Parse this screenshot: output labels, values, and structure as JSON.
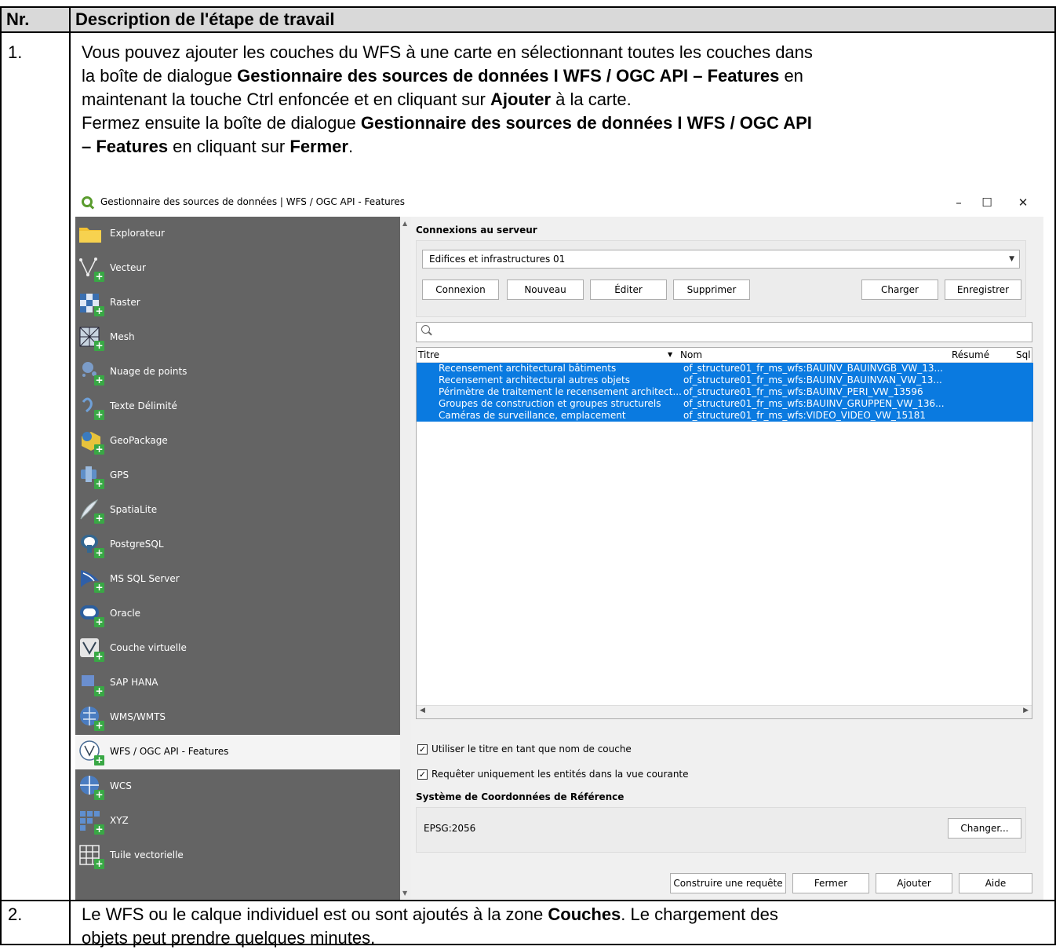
{
  "table": {
    "col_nr": "Nr.",
    "col_desc": "Description de l'étape de travail",
    "row1_nr": "1.",
    "row1_line1": "Vous pouvez ajouter les couches du WFS à une carte en sélectionnant toutes les couches dans",
    "row1_line2_pre": "la boîte de dialogue ",
    "row1_line2_bold": "Gestionnaire des sources de données I WFS / OGC API – Features",
    "row1_line2_post": " en",
    "row1_line3_pre": "maintenant la touche Ctrl enfoncée et en cliquant sur ",
    "row1_line3_bold": "Ajouter",
    "row1_line3_post": " à la carte.",
    "row1_line4_pre": "Fermez ensuite la boîte de dialogue ",
    "row1_line4_bold": "Gestionnaire des sources de données I WFS / OGC API",
    "row1_line5_bold1": "– Features",
    "row1_line5_mid": " en cliquant sur ",
    "row1_line5_bold2": "Fermer",
    "row1_line5_post": ".",
    "row2_nr": "2.",
    "row2_line1_pre": "Le WFS ou le calque individuel est ou sont ajoutés à la zone ",
    "row2_line1_bold": "Couches",
    "row2_line1_post": ". Le chargement des",
    "row2_line2": "objets peut prendre quelques minutes."
  },
  "dialog": {
    "title": "Gestionnaire des sources de données | WFS / OGC API - Features",
    "window_buttons": [
      "–",
      "☐",
      "✕"
    ],
    "sidebar": [
      {
        "label": "Explorateur",
        "icon": "folder-icon"
      },
      {
        "label": "Vecteur",
        "icon": "vector-icon"
      },
      {
        "label": "Raster",
        "icon": "raster-icon"
      },
      {
        "label": "Mesh",
        "icon": "mesh-icon"
      },
      {
        "label": "Nuage de points",
        "icon": "point-cloud-icon"
      },
      {
        "label": "Texte Délimité",
        "icon": "delimited-text-icon"
      },
      {
        "label": "GeoPackage",
        "icon": "geopackage-icon"
      },
      {
        "label": "GPS",
        "icon": "gps-icon"
      },
      {
        "label": "SpatiaLite",
        "icon": "spatialite-icon"
      },
      {
        "label": "PostgreSQL",
        "icon": "postgresql-icon"
      },
      {
        "label": "MS SQL Server",
        "icon": "mssql-icon"
      },
      {
        "label": "Oracle",
        "icon": "oracle-icon"
      },
      {
        "label": "Couche virtuelle",
        "icon": "virtual-layer-icon"
      },
      {
        "label": "SAP HANA",
        "icon": "sap-hana-icon"
      },
      {
        "label": "WMS/WMTS",
        "icon": "wms-icon"
      },
      {
        "label": "WFS / OGC API - Features",
        "icon": "wfs-icon"
      },
      {
        "label": "WCS",
        "icon": "wcs-icon"
      },
      {
        "label": "XYZ",
        "icon": "xyz-icon"
      },
      {
        "label": "Tuile vectorielle",
        "icon": "vector-tile-icon"
      }
    ],
    "selected_sidebar": "WFS / OGC API - Features",
    "connexions_title": "Connexions au serveur",
    "connection_selected": "Edifices et infrastructures 01",
    "buttons": {
      "connexion": "Connexion",
      "nouveau": "Nouveau",
      "editer": "Éditer",
      "supprimer": "Supprimer",
      "charger": "Charger",
      "enregistrer": "Enregistrer"
    },
    "search_placeholder": "",
    "columns": [
      "Titre",
      "Nom",
      "Résumé",
      "Sql"
    ],
    "rows": [
      {
        "titre": "Recensement architectural bâtiments",
        "nom": "of_structure01_fr_ms_wfs:BAUINV_BAUINVGB_VW_13..."
      },
      {
        "titre": "Recensement architectural autres objets",
        "nom": "of_structure01_fr_ms_wfs:BAUINV_BAUINVAN_VW_13..."
      },
      {
        "titre": "Périmètre de traitement le recensement architect...",
        "nom": "of_structure01_fr_ms_wfs:BAUINV_PERI_VW_13596"
      },
      {
        "titre": "Groupes de construction et groupes structurels",
        "nom": "of_structure01_fr_ms_wfs:BAUINV_GRUPPEN_VW_136..."
      },
      {
        "titre": "Caméras de surveillance, emplacement",
        "nom": "of_structure01_fr_ms_wfs:VIDEO_VIDEO_VW_15181"
      }
    ],
    "check_title": "Utiliser le titre en tant que nom de couche",
    "check_query": "Requêter uniquement les entités dans la vue courante",
    "crs_title": "Système de Coordonnées de Référence",
    "crs_value": "EPSG:2056",
    "btn_changer": "Changer...",
    "btn_construire": "Construire une requête",
    "btn_fermer": "Fermer",
    "btn_ajouter": "Ajouter",
    "btn_aide": "Aide"
  },
  "colors": {
    "header_bg": "#d9d9d9",
    "sidebar_bg": "#646464",
    "selection": "#0a7ae0",
    "qgis_green": "#5a9c2e"
  }
}
